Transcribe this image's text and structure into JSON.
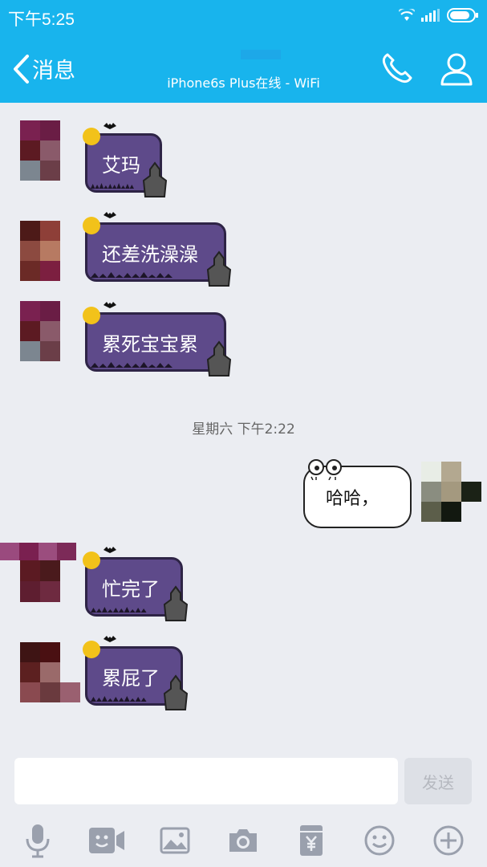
{
  "status_bar": {
    "time": "下午5:25"
  },
  "header": {
    "back_label": "消息",
    "subtitle": "iPhone6s Plus在线 - WiFi"
  },
  "messages": [
    {
      "side": "left",
      "text": "艾玛"
    },
    {
      "side": "left",
      "text": "还差洗澡澡"
    },
    {
      "side": "left",
      "text": "累死宝宝累"
    },
    {
      "side": "right",
      "text": "哈哈，"
    },
    {
      "side": "left",
      "text": "忙完了"
    },
    {
      "side": "left",
      "text": "累屁了"
    }
  ],
  "time_separator": "星期六 下午2:22",
  "input": {
    "value": "",
    "send_label": "发送"
  },
  "toolbar_icons": [
    "microphone-icon",
    "video-icon",
    "image-icon",
    "camera-icon",
    "red-packet-icon",
    "emoji-icon",
    "plus-icon"
  ],
  "colors": {
    "header_bg": "#18b4ed",
    "bubble_bg": "#5e4a8a",
    "page_bg": "#ebedf2",
    "icon_gray": "#9aa0ad"
  }
}
